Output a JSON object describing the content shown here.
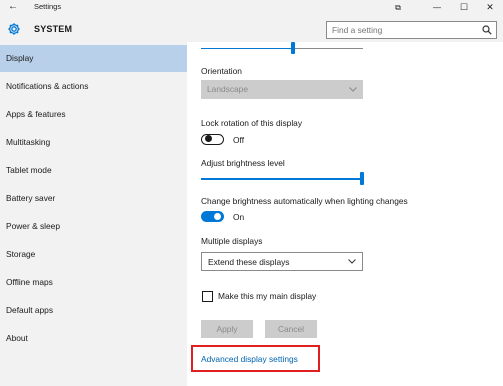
{
  "titlebar": {
    "back_glyph": "←",
    "title": "Settings",
    "snap_glyph": "⧉",
    "minimize_glyph": "—",
    "maximize_glyph": "☐",
    "close_glyph": "✕"
  },
  "header": {
    "title": "SYSTEM",
    "icon": "gear-icon",
    "search_placeholder": "Find a setting",
    "search_icon": "search-icon"
  },
  "sidebar": {
    "items": [
      {
        "label": "Display",
        "active": true
      },
      {
        "label": "Notifications & actions"
      },
      {
        "label": "Apps & features"
      },
      {
        "label": "Multitasking"
      },
      {
        "label": "Tablet mode"
      },
      {
        "label": "Battery saver"
      },
      {
        "label": "Power & sleep"
      },
      {
        "label": "Storage"
      },
      {
        "label": "Offline maps"
      },
      {
        "label": "Default apps"
      },
      {
        "label": "About"
      }
    ]
  },
  "content": {
    "orientation": {
      "label": "Orientation",
      "value": "Landscape"
    },
    "lock_rotation": {
      "label": "Lock rotation of this display",
      "state": "Off"
    },
    "brightness": {
      "label": "Adjust brightness level",
      "level": 1.0
    },
    "auto_brightness": {
      "label": "Change brightness automatically when lighting changes",
      "state": "On"
    },
    "multiple_displays": {
      "label": "Multiple displays",
      "value": "Extend these displays"
    },
    "main_display": {
      "label": "Make this my main display",
      "checked": false
    },
    "apply_label": "Apply",
    "cancel_label": "Cancel",
    "advanced_link": "Advanced display settings"
  },
  "colors": {
    "accent": "#0078d7",
    "nav_selected": "#b8d0ea",
    "highlight_box": "#e02020",
    "link": "#0063b1"
  }
}
